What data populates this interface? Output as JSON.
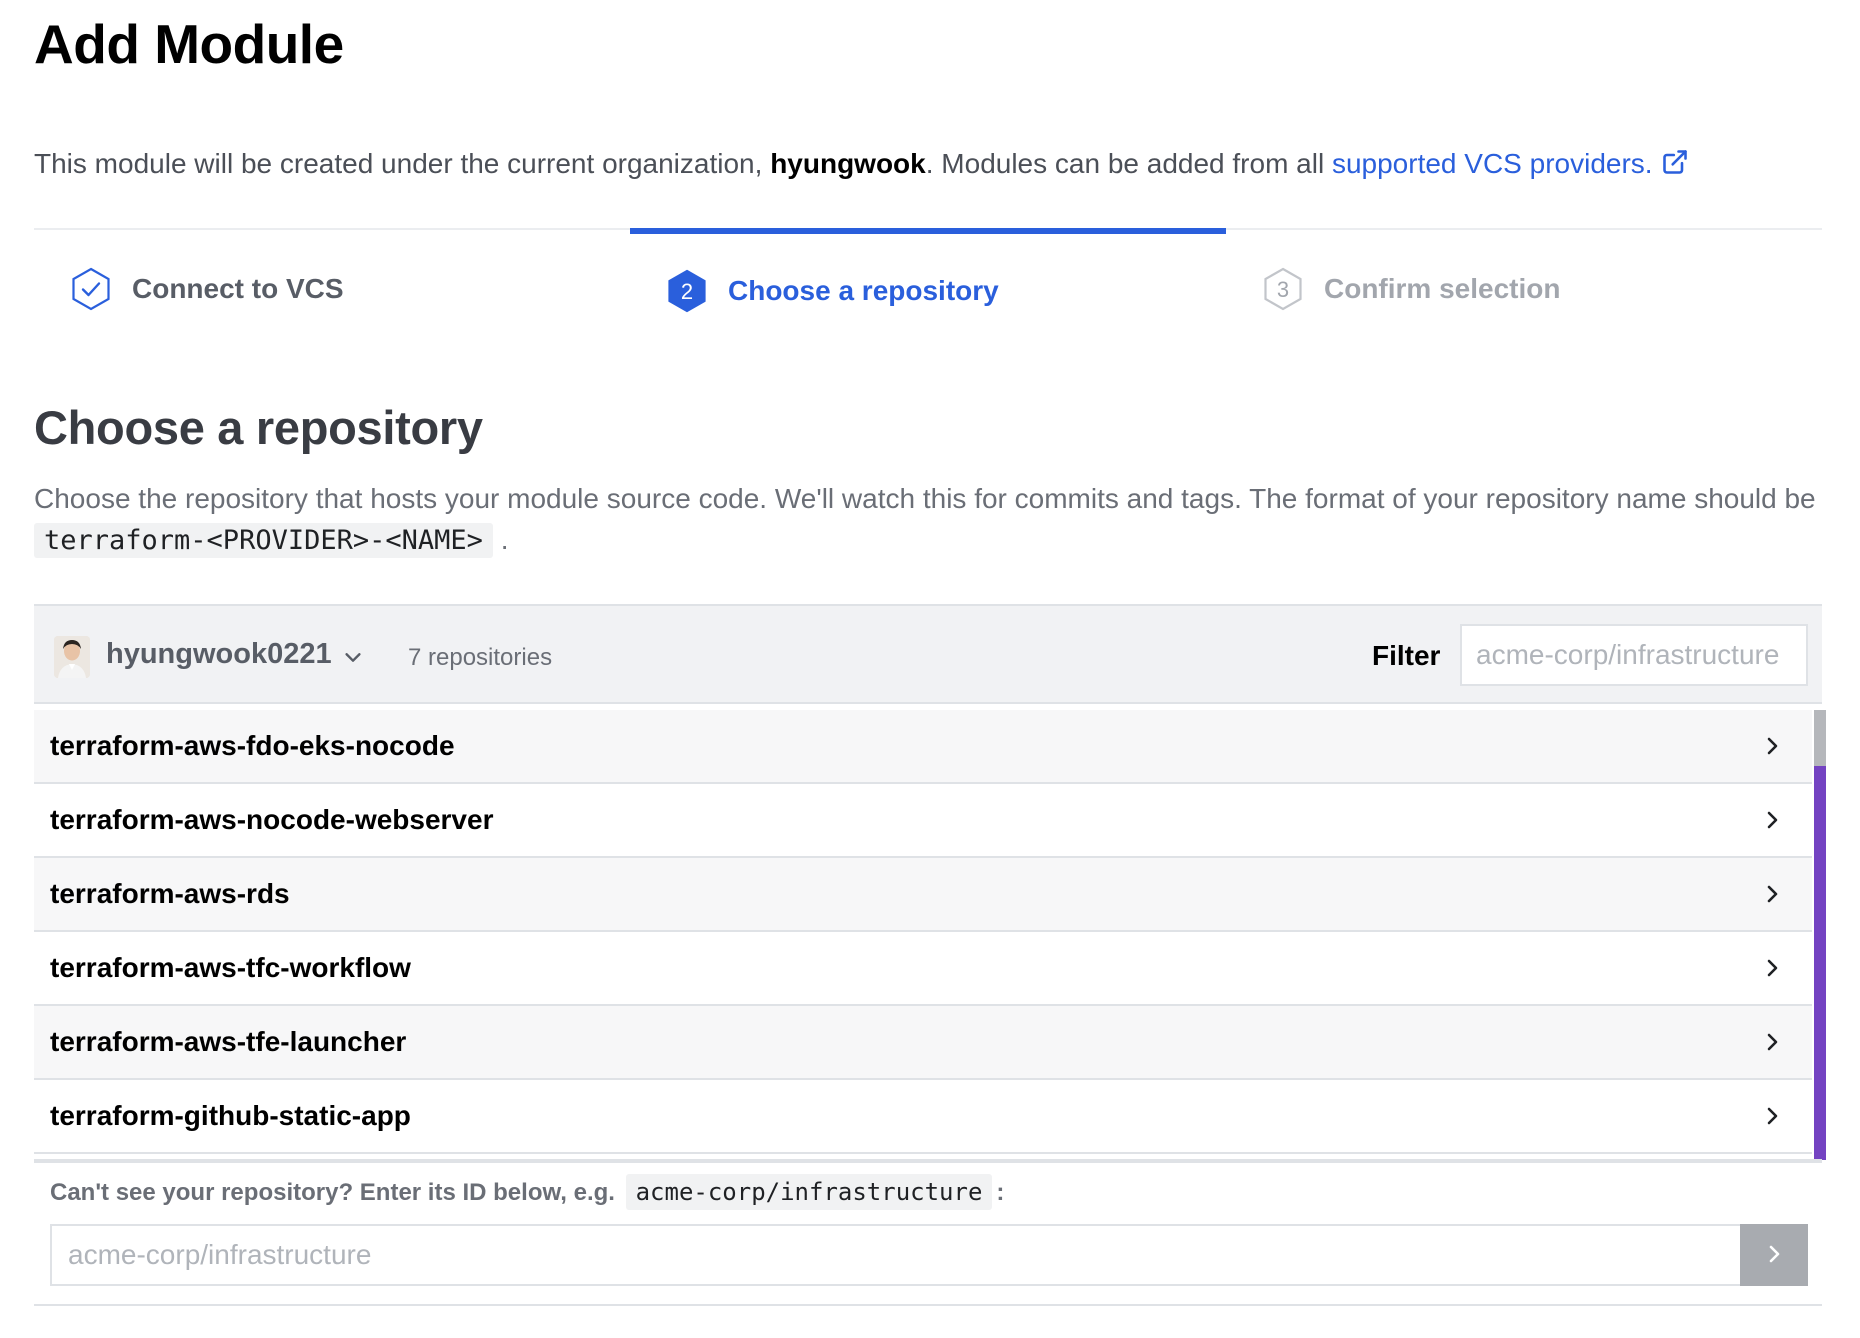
{
  "page": {
    "title": "Add Module"
  },
  "intro": {
    "text_before": "This module will be created under the current organization, ",
    "organization": "hyungwook",
    "text_after": ". Modules can be added from all ",
    "link_label": "supported VCS providers."
  },
  "steps": [
    {
      "number": "",
      "label": "Connect to VCS",
      "state": "done"
    },
    {
      "number": "2",
      "label": "Choose a repository",
      "state": "active"
    },
    {
      "number": "3",
      "label": "Confirm selection",
      "state": "pending"
    }
  ],
  "section": {
    "title": "Choose a repository",
    "description": "Choose the repository that hosts your module source code. We'll watch this for commits and tags. The format of your repository name should be ",
    "format_code": "terraform-<PROVIDER>-<NAME>",
    "description_end": "."
  },
  "repo_header": {
    "account": "hyungwook0221",
    "count_label": "7 repositories",
    "filter_label": "Filter",
    "filter_placeholder": "acme-corp/infrastructure"
  },
  "repositories": [
    "terraform-aws-fdo-eks-nocode",
    "terraform-aws-nocode-webserver",
    "terraform-aws-rds",
    "terraform-aws-tfc-workflow",
    "terraform-aws-tfe-launcher",
    "terraform-github-static-app"
  ],
  "manual_entry": {
    "prompt": "Can't see your repository? Enter its ID below, e.g.",
    "example_code": "acme-corp/infrastructure",
    "prompt_end": ":",
    "placeholder": "acme-corp/infrastructure"
  },
  "colors": {
    "accent": "#2a5fdc",
    "scrollbar": "#7443c2",
    "muted": "#a2a6ad"
  }
}
